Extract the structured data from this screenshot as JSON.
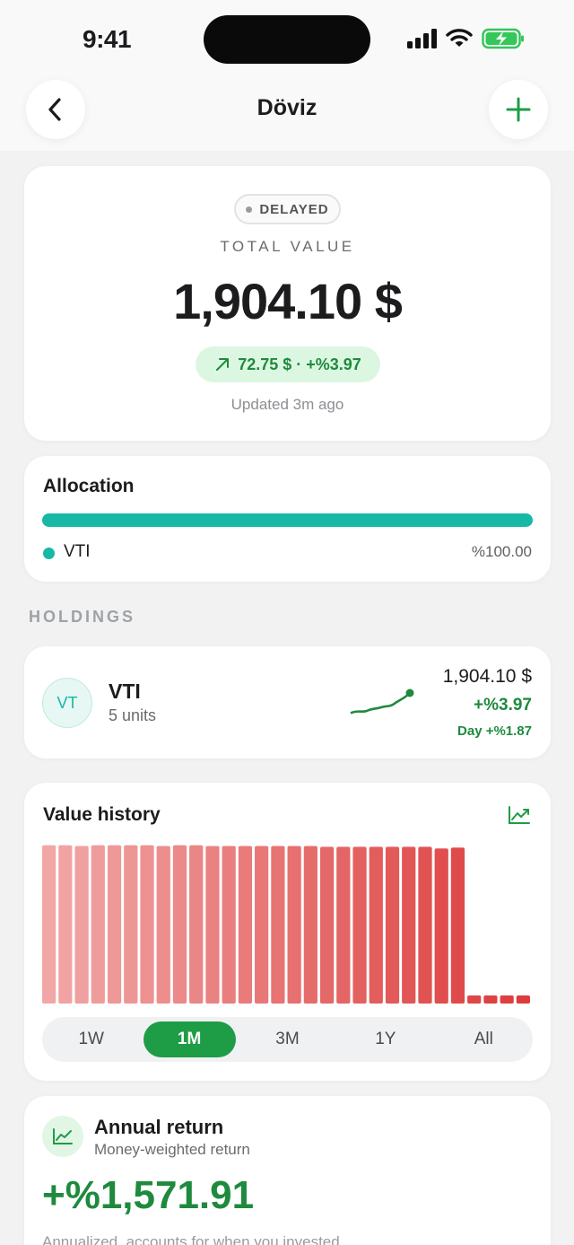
{
  "status_bar": {
    "time": "9:41"
  },
  "nav": {
    "title": "Döviz",
    "back_icon": "chevron-left-icon",
    "add_icon": "plus-icon",
    "accent": "#1e9c46"
  },
  "total": {
    "badge": "DELAYED",
    "label": "TOTAL VALUE",
    "value": "1,904.10 $",
    "change": "72.75 $ · +%3.97",
    "change_icon": "arrow-up-right-icon",
    "updated": "Updated 3m ago"
  },
  "allocation": {
    "title": "Allocation",
    "items": [
      {
        "name": "VTI",
        "percent": "%100.00",
        "share": 1.0,
        "color": "#17b8a6"
      }
    ]
  },
  "holdings": {
    "section_label": "HOLDINGS",
    "items": [
      {
        "avatar": "VT",
        "name": "VTI",
        "units": "5 units",
        "value": "1,904.10 $",
        "change": "+%3.97",
        "day_change": "Day +%1.87"
      }
    ]
  },
  "value_history": {
    "title": "Value history",
    "icon": "line-chart-icon",
    "tabs": [
      "1W",
      "1M",
      "3M",
      "1Y",
      "All"
    ],
    "active_tab": "1M"
  },
  "chart_data": {
    "type": "bar",
    "title": "Value history",
    "values": [
      98,
      98,
      97.5,
      98,
      98,
      98,
      98,
      97.5,
      98,
      98,
      97.5,
      97.5,
      97.5,
      97.5,
      97.5,
      97.5,
      97.5,
      97,
      97,
      97,
      97,
      97,
      97,
      97,
      96,
      96.5,
      5,
      5,
      5,
      5
    ],
    "ylim": [
      0,
      100
    ],
    "color_start": "#f2a7a7",
    "color_end": "#dc3c3c"
  },
  "annual_return": {
    "icon": "trend-up-icon",
    "title": "Annual return",
    "subtitle": "Money-weighted return",
    "value": "+%1,571.91",
    "note": "Annualized, accounts for when you invested"
  }
}
